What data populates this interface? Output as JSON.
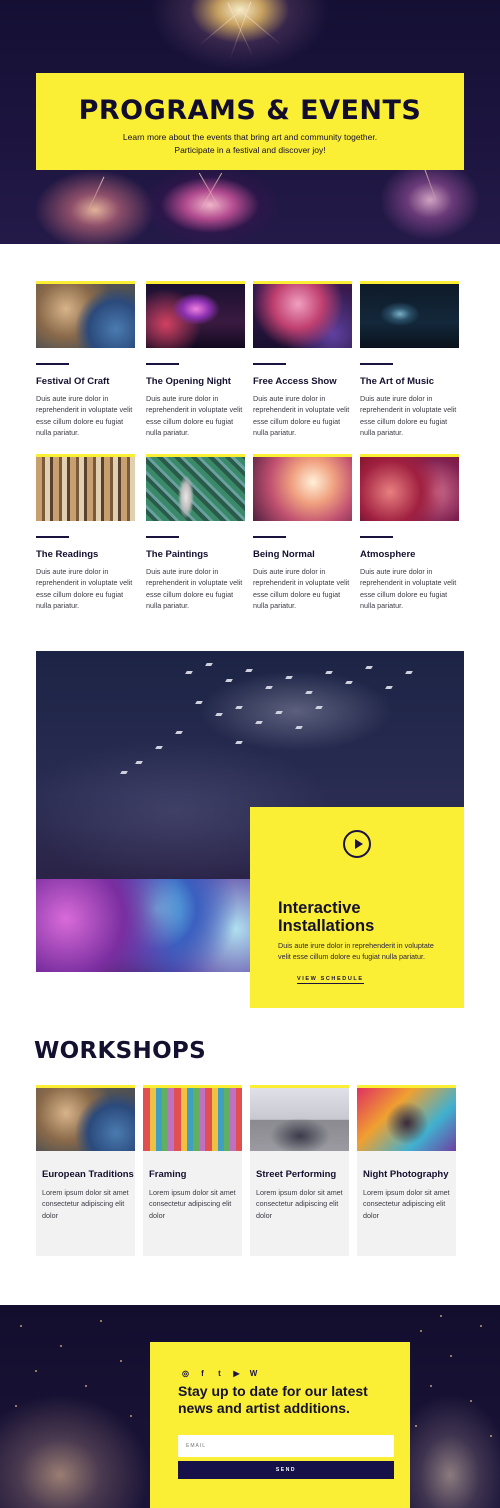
{
  "hero": {
    "title": "PROGRAMS & EVENTS",
    "subtitle_line1": "Learn more about the events that bring art and community together.",
    "subtitle_line2": "Participate in a festival and discover joy!"
  },
  "events": [
    {
      "title": "Festival Of Craft",
      "desc": "Duis aute irure dolor in reprehenderit in voluptate velit esse cillum dolore eu fugiat nulla pariatur."
    },
    {
      "title": "The Opening Night",
      "desc": "Duis aute irure dolor in reprehenderit in voluptate velit esse cillum dolore eu fugiat nulla pariatur."
    },
    {
      "title": "Free Access Show",
      "desc": "Duis aute irure dolor in reprehenderit in voluptate velit esse cillum dolore eu fugiat nulla pariatur."
    },
    {
      "title": "The Art of Music",
      "desc": "Duis aute irure dolor in reprehenderit in voluptate velit esse cillum dolore eu fugiat nulla pariatur."
    },
    {
      "title": "The Readings",
      "desc": "Duis aute irure dolor in reprehenderit in voluptate velit esse cillum dolore eu fugiat nulla pariatur."
    },
    {
      "title": "The Paintings",
      "desc": "Duis aute irure dolor in reprehenderit in voluptate velit esse cillum dolore eu fugiat nulla pariatur."
    },
    {
      "title": "Being Normal",
      "desc": "Duis aute irure dolor in reprehenderit in voluptate velit esse cillum dolore eu fugiat nulla pariatur."
    },
    {
      "title": "Atmosphere",
      "desc": "Duis aute irure dolor in reprehenderit in voluptate velit esse cillum dolore eu fugiat nulla pariatur."
    }
  ],
  "feature": {
    "title": "Interactive Installations",
    "desc": "Duis aute irure dolor in reprehenderit in voluptate velit esse cillum dolore eu fugiat nulla pariatur.",
    "link": "VIEW SCHEDULE"
  },
  "workshops": {
    "title": "WORKSHOPS",
    "items": [
      {
        "title": "European Traditions",
        "desc": "Lorem ipsum dolor sit amet consectetur adipiscing elit dolor"
      },
      {
        "title": "Framing",
        "desc": "Lorem ipsum dolor sit amet consectetur adipiscing elit dolor"
      },
      {
        "title": "Street Performing",
        "desc": "Lorem ipsum dolor sit amet consectetur adipiscing elit dolor"
      },
      {
        "title": "Night Photography",
        "desc": "Lorem ipsum dolor sit amet consectetur adipiscing elit dolor"
      }
    ]
  },
  "newsletter": {
    "social": {
      "instagram": "◎",
      "facebook": "f",
      "twitter": "t",
      "youtube": "▶",
      "wordpress": "W"
    },
    "title": "Stay up to date for our latest news and artist additions.",
    "email_placeholder": "EMAIL",
    "send_label": "SEND"
  },
  "colors": {
    "accent": "#fbef35",
    "navy": "#17114a"
  }
}
